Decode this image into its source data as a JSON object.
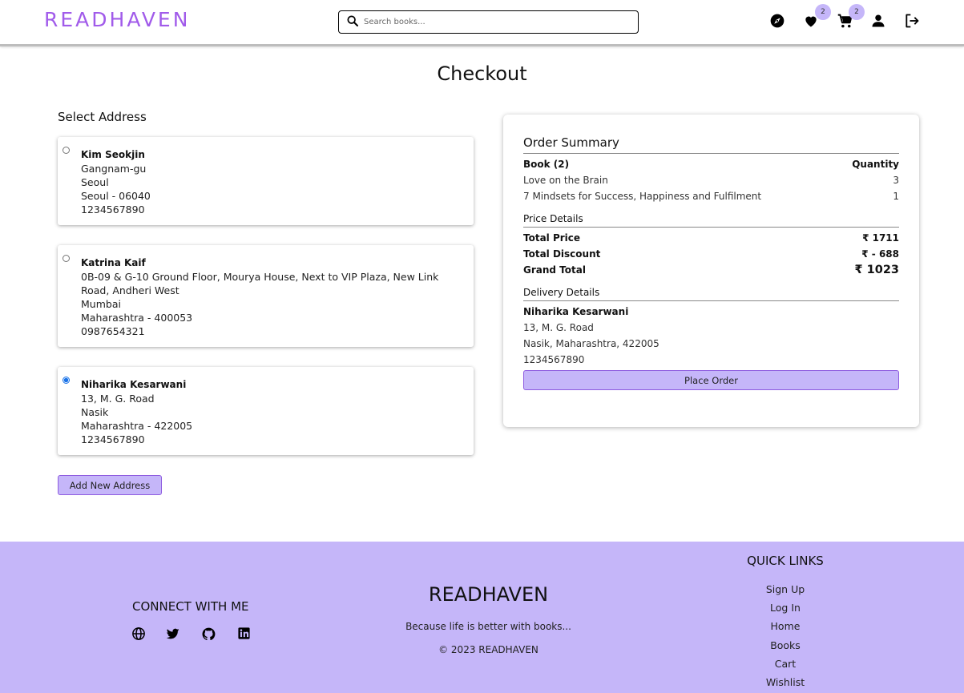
{
  "header": {
    "logo": "READHAVEN",
    "search_placeholder": "Search books...",
    "wishlist_count": "2",
    "cart_count": "2"
  },
  "page_title": "Checkout",
  "address_section": {
    "label": "Select Address",
    "addresses": [
      {
        "name": "Kim Seokjin",
        "lines": [
          "Gangnam-gu",
          "Seoul",
          "Seoul - 06040",
          "1234567890"
        ],
        "selected": false
      },
      {
        "name": "Katrina Kaif",
        "lines": [
          "0B-09 & G-10 Ground Floor, Mourya House, Next to VIP Plaza, New Link Road, Andheri West",
          "Mumbai",
          "Maharashtra - 400053",
          "0987654321"
        ],
        "selected": false
      },
      {
        "name": "Niharika Kesarwani",
        "lines": [
          "13, M. G. Road",
          "Nasik",
          "Maharashtra - 422005",
          "1234567890"
        ],
        "selected": true
      }
    ],
    "add_button": "Add New Address"
  },
  "summary": {
    "title": "Order Summary",
    "book_header": "Book (2)",
    "qty_header": "Quantity",
    "items": [
      {
        "title": "Love on the Brain",
        "qty": "3"
      },
      {
        "title": "7 Mindsets for Success, Happiness and Fulfilment",
        "qty": "1"
      }
    ],
    "price_title": "Price Details",
    "total_price_label": "Total Price",
    "total_price": "₹ 1711",
    "total_discount_label": "Total Discount",
    "total_discount": "₹ - 688",
    "grand_total_label": "Grand Total",
    "grand_total": "₹ 1023",
    "delivery_title": "Delivery Details",
    "delivery_name": "Niharika Kesarwani",
    "delivery_street": "13, M. G. Road",
    "delivery_city": "Nasik, Maharashtra, 422005",
    "delivery_phone": "1234567890",
    "place_order": "Place Order"
  },
  "footer": {
    "connect_title": "CONNECT WITH ME",
    "logo": "READHAVEN",
    "tagline": "Because life is better with books...",
    "copyright": "© 2023 READHAVEN",
    "quick_links_title": "QUICK LINKS",
    "quick_links": [
      "Sign Up",
      "Log In",
      "Home",
      "Books",
      "Cart",
      "Wishlist"
    ]
  },
  "icons": [
    "search-icon",
    "explore-icon",
    "heart-icon",
    "cart-icon",
    "user-icon",
    "logout-icon",
    "globe-icon",
    "twitter-icon",
    "github-icon",
    "linkedin-icon"
  ],
  "colors": {
    "accent": "#a15bea",
    "lavender": "#c5b6f9",
    "button_border": "#8e5ce0"
  }
}
